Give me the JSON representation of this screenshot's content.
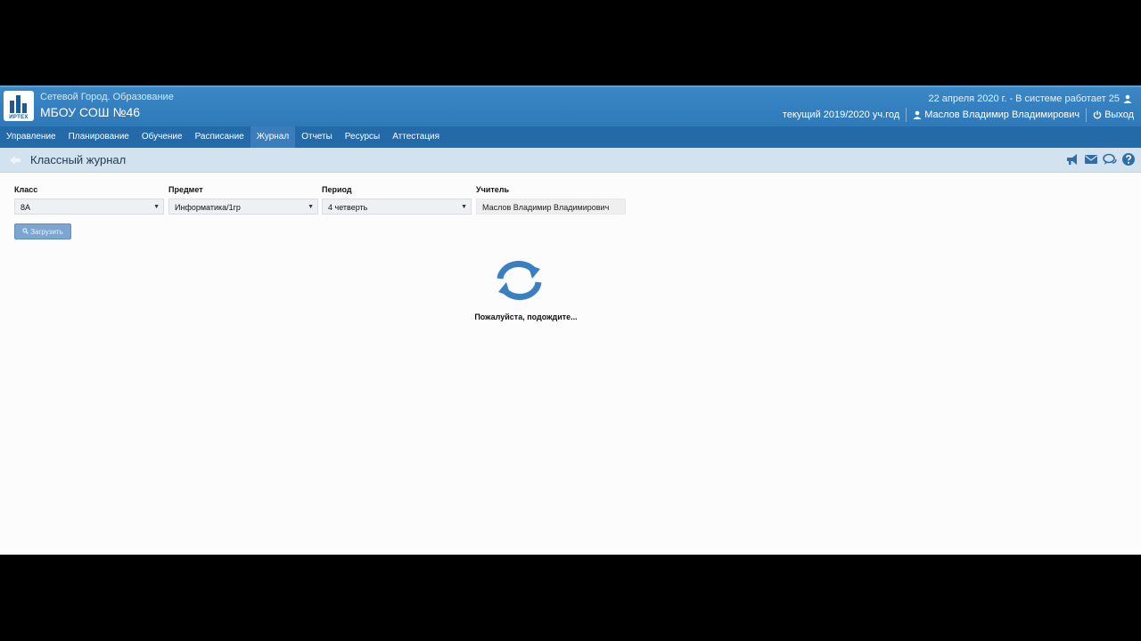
{
  "header": {
    "logo_caption": "ИРТЕХ",
    "app_name": "Сетевой Город. Образование",
    "school_name": "МБОУ СОШ №46",
    "system_info": "22 апреля 2020 г. - В системе работает 25",
    "academic_year": "текущий 2019/2020 уч.год",
    "user_name": "Маслов Владимир Владимирович",
    "logout_label": "Выход"
  },
  "menu": {
    "items": [
      {
        "label": "Управление"
      },
      {
        "label": "Планирование"
      },
      {
        "label": "Обучение"
      },
      {
        "label": "Расписание"
      },
      {
        "label": "Журнал"
      },
      {
        "label": "Отчеты"
      },
      {
        "label": "Ресурсы"
      },
      {
        "label": "Аттестация"
      }
    ],
    "active": "Журнал"
  },
  "page": {
    "title": "Классный журнал"
  },
  "form": {
    "class": {
      "label": "Класс",
      "value": "8А"
    },
    "subject": {
      "label": "Предмет",
      "value": "Информатика/1гр"
    },
    "period": {
      "label": "Период",
      "value": "4 четверть"
    },
    "teacher": {
      "label": "Учитель",
      "value": "Маслов Владимир Владимирович"
    },
    "load_button": "Загрузить"
  },
  "loading": {
    "message": "Пожалуйста, подождите..."
  },
  "colors": {
    "header_blue": "#3a87c6",
    "menu_blue": "#2469a8",
    "accent": "#3a7fc1"
  },
  "icons": [
    "logo-icon",
    "user-icon",
    "power-icon",
    "back-arrow-icon",
    "megaphone-icon",
    "mail-icon",
    "chat-icon",
    "help-icon",
    "search-icon",
    "refresh-icon"
  ]
}
